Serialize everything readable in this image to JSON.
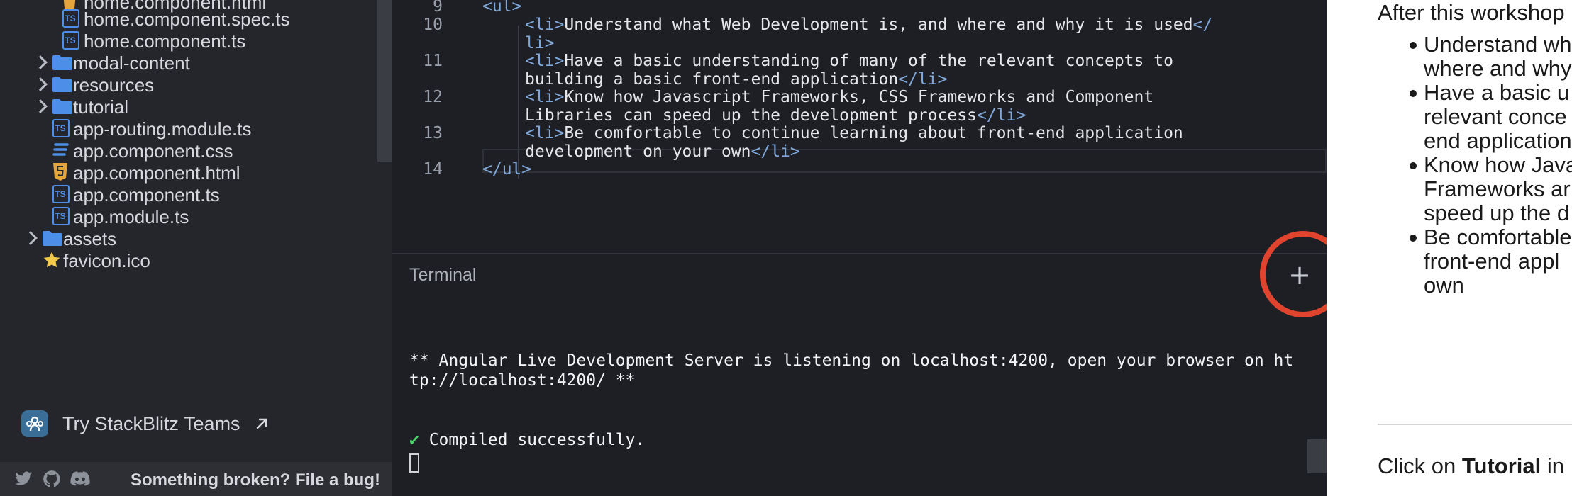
{
  "sidebar": {
    "files": [
      {
        "label": "home.component.html",
        "icon": "html-file-icon"
      },
      {
        "label": "home.component.spec.ts",
        "icon": "typescript-file-icon"
      },
      {
        "label": "home.component.ts",
        "icon": "typescript-file-icon"
      },
      {
        "label": "modal-content",
        "icon": "folder-icon"
      },
      {
        "label": "resources",
        "icon": "folder-icon"
      },
      {
        "label": "tutorial",
        "icon": "folder-icon"
      },
      {
        "label": "app-routing.module.ts",
        "icon": "typescript-file-icon"
      },
      {
        "label": "app.component.css",
        "icon": "css-file-icon"
      },
      {
        "label": "app.component.html",
        "icon": "html-file-icon"
      },
      {
        "label": "app.component.ts",
        "icon": "typescript-file-icon"
      },
      {
        "label": "app.module.ts",
        "icon": "typescript-file-icon"
      },
      {
        "label": "assets",
        "icon": "folder-icon"
      },
      {
        "label": "favicon.ico",
        "icon": "star-icon"
      }
    ],
    "teams_label": "Try StackBlitz Teams",
    "footer_text": "Something broken? File a bug!"
  },
  "editor": {
    "lines": [
      {
        "num": "9",
        "text": "<ul>"
      },
      {
        "num": "10",
        "text_a": "<li>",
        "text_b": "Understand what Web Development is, and where and why it is used",
        "text_c": "</",
        "wrap": "li>"
      },
      {
        "num": "11",
        "text_a": "<li>",
        "text_b": "Have a basic understanding of many of the relevant concepts to",
        "wrap_b": "building a basic front-end application",
        "wrap_c": "</li>"
      },
      {
        "num": "12",
        "text_a": "<li>",
        "text_b": "Know how Javascript Frameworks, CSS Frameworks and Component",
        "wrap_b": "Libraries can speed up the development process",
        "wrap_c": "</li>"
      },
      {
        "num": "13",
        "text_a": "<li>",
        "text_b": "Be comfortable to continue learning about front-end application",
        "wrap_b": "development on your own",
        "wrap_c": "</li>"
      },
      {
        "num": "14",
        "text": "</ul>"
      }
    ]
  },
  "terminal": {
    "title": "Terminal",
    "plus": "+",
    "line1": "** Angular Live Development Server is listening on localhost:4200, open your browser on ht",
    "line2": "tp://localhost:4200/ **",
    "check": "✔",
    "compiled": " Compiled successfully."
  },
  "right": {
    "intro": "After this workshop",
    "bullets": [
      [
        "Understand wh",
        "where and why"
      ],
      [
        "Have a basic u",
        "relevant conce",
        "end application"
      ],
      [
        "Know how Java",
        "Frameworks ar",
        "speed up the d"
      ],
      [
        "Be comfortable",
        "front-end appl",
        "own"
      ]
    ],
    "cta_prefix": "Click on ",
    "cta_bold": "Tutorial",
    "cta_suffix": " in"
  },
  "colors": {
    "accent_red": "#e0442f",
    "folder_blue": "#4d8ee8",
    "tag_blue": "#7fa7d9",
    "check_green": "#4fd16b"
  }
}
